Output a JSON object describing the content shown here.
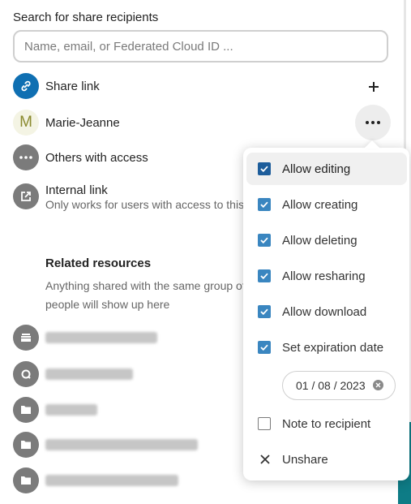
{
  "search": {
    "label": "Search for share recipients",
    "placeholder": "Name, email, or Federated Cloud ID ..."
  },
  "share_link": {
    "label": "Share link"
  },
  "recipient": {
    "initial": "M",
    "name": "Marie-Jeanne"
  },
  "others": {
    "label": "Others with access"
  },
  "internal_link": {
    "title": "Internal link",
    "subtitle": "Only works for users with access to this folder"
  },
  "related": {
    "title": "Related resources",
    "description": "Anything shared with the same group of people will show up here"
  },
  "permissions_menu": {
    "items": [
      {
        "label": "Allow editing",
        "checked": true
      },
      {
        "label": "Allow creating",
        "checked": true
      },
      {
        "label": "Allow deleting",
        "checked": true
      },
      {
        "label": "Allow resharing",
        "checked": true
      },
      {
        "label": "Allow download",
        "checked": true
      },
      {
        "label": "Set expiration date",
        "checked": true
      }
    ],
    "expiration_date": "01 / 08 / 2023",
    "note": {
      "label": "Note to recipient",
      "checked": false
    },
    "unshare": {
      "label": "Unshare"
    }
  },
  "colors": {
    "link_blue": "#0f6fb2",
    "checkbox_blue": "#3a86c0",
    "icon_grey": "#7b7b7b",
    "accent_teal": "#0e7c86"
  }
}
